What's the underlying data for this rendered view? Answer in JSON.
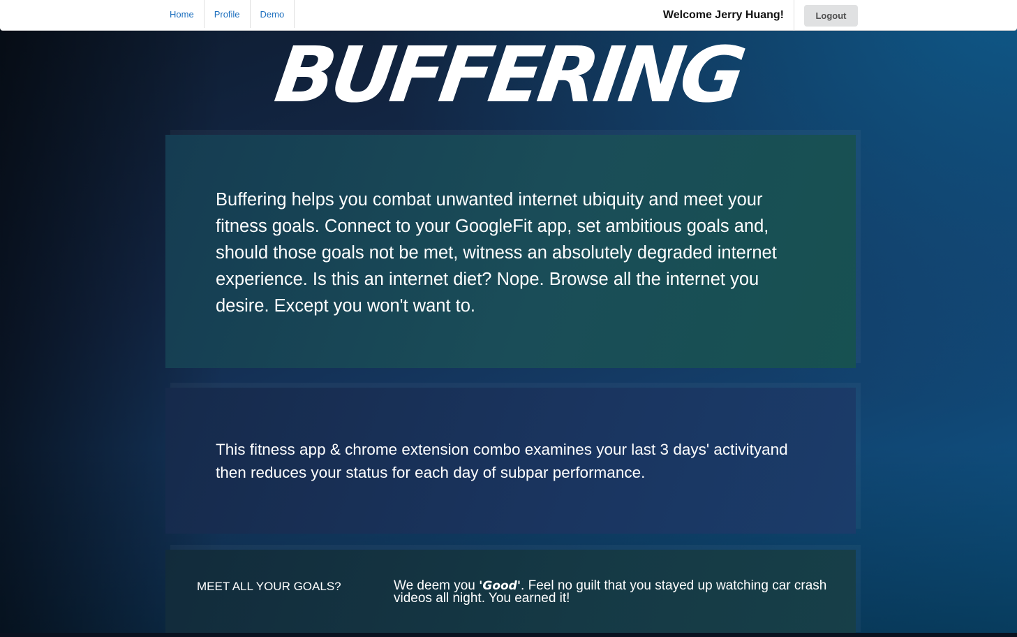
{
  "nav": {
    "items": [
      {
        "label": "Home"
      },
      {
        "label": "Profile"
      },
      {
        "label": "Demo"
      }
    ],
    "welcome": "Welcome Jerry Huang!",
    "logout_label": "Logout"
  },
  "hero": {
    "title": "BUFFERING"
  },
  "intro": {
    "text": "Buffering helps you combat unwanted internet ubiquity and meet your fitness goals. Connect to your GoogleFit app, set ambitious goals and, should those goals not be met, witness an absolutely degraded internet experience. Is this an internet diet? Nope. Browse all the internet you desire. Except you won't want to."
  },
  "how_it_works": {
    "text": "This fitness app & chrome extension combo examines your last 3 days' activityand then reduces your status for each day of subpar performance."
  },
  "goals": {
    "label": "MEET ALL YOUR GOALS?",
    "text_before": "We deem you ",
    "status_word": "'Good'",
    "text_after": ". Feel no guilt that you stayed up watching car crash videos all night. You earned it!"
  },
  "colors": {
    "nav_link": "#1e70bf",
    "logout_bg": "#e0e1e2",
    "card_intro": "#1a4d58",
    "card_how": "#1a3560",
    "card_goals": "#153945"
  }
}
